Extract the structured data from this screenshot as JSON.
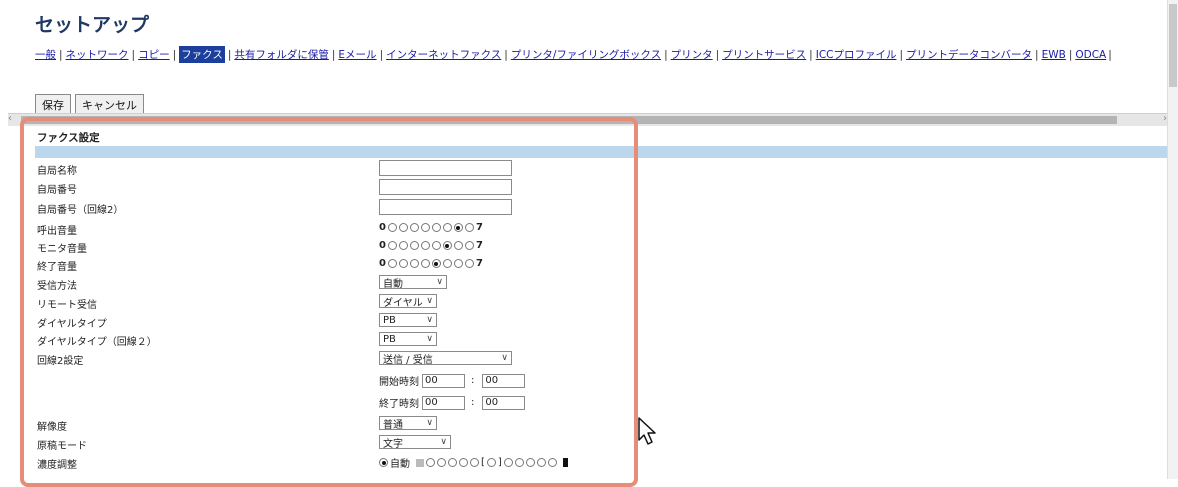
{
  "page": {
    "title": "セットアップ"
  },
  "nav": {
    "items": [
      {
        "label": "一般"
      },
      {
        "label": "ネットワーク"
      },
      {
        "label": "コピー"
      },
      {
        "label": "ファクス",
        "active": true
      },
      {
        "label": "共有フォルダに保管"
      },
      {
        "label": "Eメール"
      },
      {
        "label": "インターネットファクス"
      },
      {
        "label": "プリンタ/ファイリングボックス"
      },
      {
        "label": "プリンタ"
      },
      {
        "label": "プリントサービス"
      },
      {
        "label": "ICCプロファイル"
      },
      {
        "label": "プリントデータコンバータ"
      },
      {
        "label": "EWB"
      },
      {
        "label": "ODCA"
      }
    ]
  },
  "toolbar": {
    "save_label": "保存",
    "cancel_label": "キャンセル"
  },
  "section": {
    "title": "ファクス設定"
  },
  "fields": {
    "station_name": {
      "label": "自局名称",
      "value": ""
    },
    "station_number": {
      "label": "自局番号",
      "value": ""
    },
    "station_number_line2": {
      "label": "自局番号（回線2）",
      "value": ""
    },
    "ring_volume": {
      "label": "呼出音量",
      "min": "0",
      "max": "7",
      "selected_index": 6,
      "count": 8
    },
    "monitor_volume": {
      "label": "モニタ音量",
      "min": "0",
      "max": "7",
      "selected_index": 5,
      "count": 8
    },
    "end_volume": {
      "label": "終了音量",
      "min": "0",
      "max": "7",
      "selected_index": 4,
      "count": 8
    },
    "receive_mode": {
      "label": "受信方法",
      "value": "自動"
    },
    "remote_receive": {
      "label": "リモート受信",
      "value": "ダイヤル"
    },
    "dial_type": {
      "label": "ダイヤルタイプ",
      "value": "PB"
    },
    "dial_type_line2": {
      "label": "ダイヤルタイプ（回線２）",
      "value": "PB"
    },
    "line2_setting": {
      "label": "回線2設定",
      "value": "送信 / 受信",
      "start_label": "開始時刻",
      "start_h": "00",
      "start_m": "00",
      "end_label": "終了時刻",
      "end_h": "00",
      "end_m": "00"
    },
    "resolution": {
      "label": "解像度",
      "value": "普通"
    },
    "original_mode": {
      "label": "原稿モード",
      "value": "文字"
    },
    "density": {
      "label": "濃度調整",
      "auto_label": "自動"
    }
  },
  "icons": {
    "cursor": "mouse-pointer-icon"
  }
}
